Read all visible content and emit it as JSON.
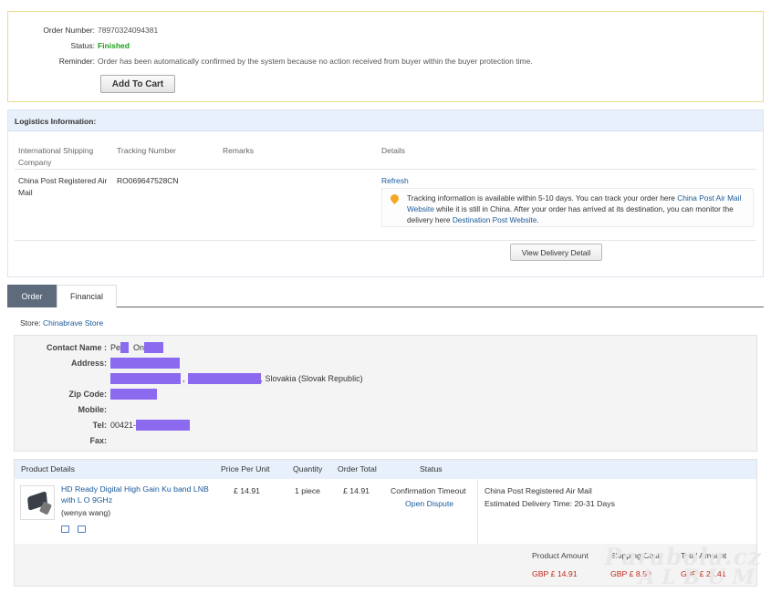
{
  "summary": {
    "order_number_label": "Order Number:",
    "order_number": "78970324094381",
    "status_label": "Status:",
    "status": "Finished",
    "reminder_label": "Reminder:",
    "reminder": "Order has been automatically confirmed by the system because no action received from buyer within the buyer protection time.",
    "add_to_cart": "Add To Cart",
    "status_color": "#1aa01a"
  },
  "logistics": {
    "title": "Logistics Information:",
    "columns": [
      "International Shipping Company",
      "Tracking Number",
      "Remarks",
      "Details"
    ],
    "carrier": "China Post Registered Air Mail",
    "tracking_number": "RO069647528CN",
    "refresh": "Refresh",
    "notice_prefix": "Tracking information is available within 5-10 days. You can track your order here ",
    "notice_link1": "China Post Air Mail Website",
    "notice_middle": " while it is still in China. After your order has arrived at its destination, you can monitor the delivery here ",
    "notice_link2": "Destination Post Website",
    "notice_suffix": ".",
    "view_delivery": "View Delivery Detail"
  },
  "tabs": [
    {
      "label": "Order",
      "active": true
    },
    {
      "label": "Financial",
      "active": false
    }
  ],
  "store": {
    "label": "Store: ",
    "name": "Chinabrave Store"
  },
  "address": {
    "contact_label": "Contact Name :",
    "contact_first": "Pe",
    "contact_last": "On",
    "address_label": "Address:",
    "country": ", Slovakia (Slovak Republic)",
    "zip_label": "Zip Code:",
    "mobile_label": "Mobile:",
    "tel_label": "Tel:",
    "tel_prefix": "00421-",
    "fax_label": "Fax:"
  },
  "products": {
    "headers": [
      "Product Details",
      "Price Per Unit",
      "Quantity",
      "Order Total",
      "Status"
    ],
    "item": {
      "name": "HD Ready Digital High Gain Ku band LNB with L O 9GHz",
      "seller": "(wenya wang)",
      "price": "£ 14.91",
      "quantity": "1 piece",
      "total": "£ 14.91",
      "status": "Confirmation Timeout",
      "dispute": "Open Dispute",
      "shipping_method": "China Post Registered Air Mail",
      "delivery_time": "Estimated Delivery Time: 20-31 Days"
    },
    "footer_headers": [
      "Product Amount",
      "Shipping Cost",
      "Total Amount"
    ],
    "footer_values": [
      "GBP £ 14.91",
      "GBP £ 8.50",
      "GBP £ 23.41"
    ]
  },
  "watermark": {
    "line1": "Parabola.cz",
    "line2": "ALBUM"
  },
  "colors": {
    "link": "#1a5a9a",
    "header_bg": "#e8f0fb",
    "amount_red": "#c0281c",
    "redaction": "#8b6af0"
  }
}
